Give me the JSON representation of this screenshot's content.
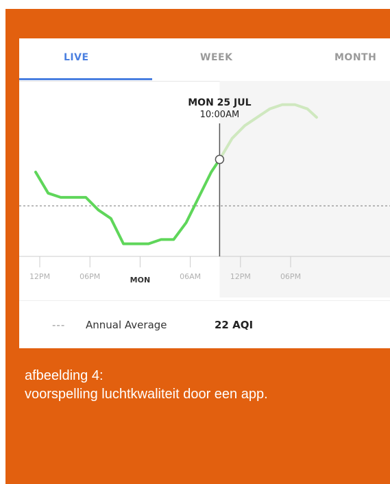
{
  "tabs": [
    {
      "label": "LIVE",
      "active": true
    },
    {
      "label": "WEEK",
      "active": false
    },
    {
      "label": "MONTH",
      "active": false
    }
  ],
  "colors": {
    "frame": "#e2600f",
    "accent": "#4a7fe0",
    "line": "#5fd65a",
    "forecast_line": "#cfe8bf"
  },
  "selection": {
    "date": "MON 25 JUL",
    "time": "10:00AM"
  },
  "legend": {
    "dash": "---",
    "label": "Annual Average",
    "value": "22 AQI"
  },
  "caption": {
    "line1": "afbeelding 4:",
    "line2": "voorspelling luchtkwaliteit door een app."
  },
  "chart_data": {
    "type": "line",
    "x_tick_labels": [
      "12PM",
      "06PM",
      "MON",
      "06AM",
      "12PM",
      "06PM"
    ],
    "bold_tick": "MON",
    "annual_average_aqi": 22,
    "series": [
      {
        "style": "observed",
        "x_hours": [
          0,
          1.5,
          3,
          4.5,
          6,
          7.5,
          9,
          10.5,
          12,
          13.5,
          15,
          16.5,
          18,
          19.5,
          21,
          22
        ],
        "y": [
          30,
          25,
          24,
          24,
          24,
          21,
          19,
          13,
          13,
          13,
          14,
          14,
          18,
          24,
          30,
          33
        ]
      },
      {
        "style": "forecast",
        "x_hours": [
          22,
          23.5,
          25,
          26.5,
          28,
          29.5,
          31,
          32.5,
          33.6
        ],
        "y": [
          33,
          38,
          41,
          43,
          45,
          46,
          46,
          45,
          43
        ]
      }
    ],
    "selected_x_hours": 22,
    "y_range": [
      10,
      50
    ]
  }
}
